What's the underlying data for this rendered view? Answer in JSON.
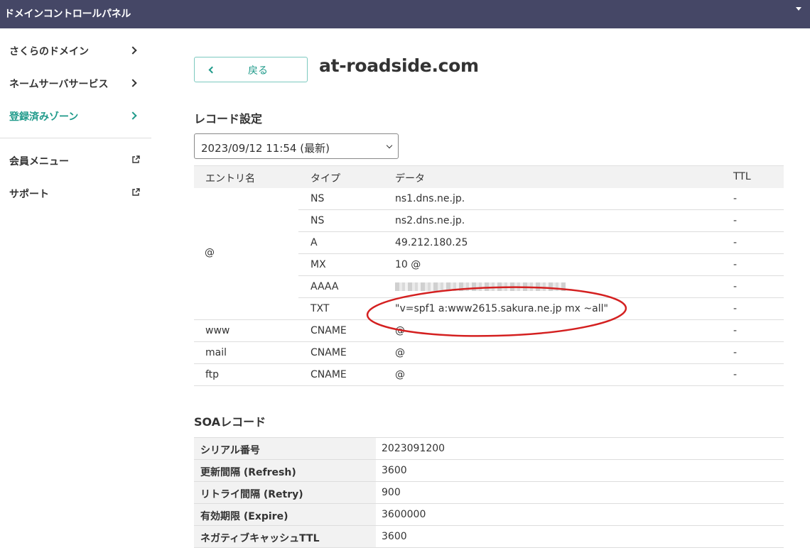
{
  "header": {
    "title": "ドメインコントロールパネル"
  },
  "sidebar": {
    "items": [
      {
        "label": "さくらのドメイン"
      },
      {
        "label": "ネームサーバサービス"
      },
      {
        "label": "登録済みゾーン"
      },
      {
        "label": "会員メニュー"
      },
      {
        "label": "サポート"
      }
    ]
  },
  "main": {
    "back_label": "戻る",
    "domain": "at-roadside.com",
    "record_section_title": "レコード設定",
    "version_select": "2023/09/12 11:54 (最新)",
    "columns": [
      "エントリ名",
      "タイプ",
      "データ",
      "TTL"
    ],
    "entries": {
      "root": "@",
      "www": "www",
      "mail": "mail",
      "ftp": "ftp"
    },
    "records": [
      {
        "type": "NS",
        "data": "ns1.dns.ne.jp.",
        "ttl": "-"
      },
      {
        "type": "NS",
        "data": "ns2.dns.ne.jp.",
        "ttl": "-"
      },
      {
        "type": "A",
        "data": "49.212.180.25",
        "ttl": "-"
      },
      {
        "type": "MX",
        "data": "10 @",
        "ttl": "-"
      },
      {
        "type": "AAAA",
        "data": "",
        "ttl": "-"
      },
      {
        "type": "TXT",
        "data": "\"v=spf1 a:www2615.sakura.ne.jp mx ~all\"",
        "ttl": "-"
      },
      {
        "type": "CNAME",
        "data": "@",
        "ttl": "-"
      },
      {
        "type": "CNAME",
        "data": "@",
        "ttl": "-"
      },
      {
        "type": "CNAME",
        "data": "@",
        "ttl": "-"
      }
    ],
    "soa_section_title": "SOAレコード",
    "soa": [
      {
        "label": "シリアル番号",
        "value": "2023091200"
      },
      {
        "label": "更新間隔 (Refresh)",
        "value": "3600"
      },
      {
        "label": "リトライ間隔 (Retry)",
        "value": "900"
      },
      {
        "label": "有効期限 (Expire)",
        "value": "3600000"
      },
      {
        "label": "ネガティブキャッシュTTL",
        "value": "3600"
      }
    ]
  },
  "colors": {
    "header_bg": "#454766",
    "accent": "#1f9a8a",
    "highlight": "#d42020"
  }
}
